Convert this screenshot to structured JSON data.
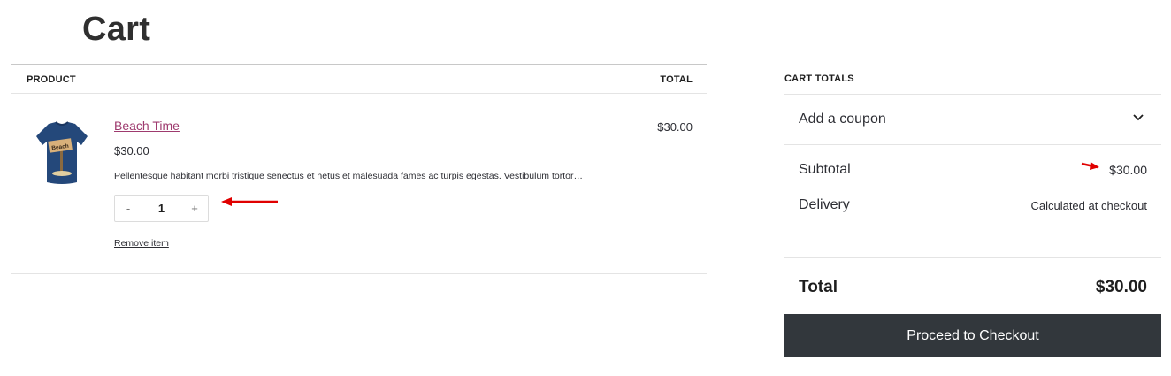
{
  "page": {
    "title": "Cart"
  },
  "cart_table": {
    "headers": {
      "product": "PRODUCT",
      "total": "TOTAL"
    },
    "items": [
      {
        "name": "Beach Time",
        "price": "$30.00",
        "description": "Pellentesque habitant morbi tristique senectus et netus et malesuada fames ac turpis egestas. Vestibulum tortor…",
        "quantity": "1",
        "qty_minus": "-",
        "qty_plus": "+",
        "remove_label": "Remove item",
        "line_total": "$30.00",
        "thumbnail_sign": "Beach"
      }
    ]
  },
  "totals": {
    "heading": "CART TOTALS",
    "coupon_label": "Add a coupon",
    "subtotal_label": "Subtotal",
    "subtotal_value": "$30.00",
    "delivery_label": "Delivery",
    "delivery_value": "Calculated at checkout",
    "total_label": "Total",
    "total_value": "$30.00",
    "checkout_label": "Proceed to Checkout"
  },
  "colors": {
    "accent_link": "#9e3a6e",
    "button_bg": "#32373c",
    "annotation_arrow": "#e00000"
  },
  "icons": [
    "chevron-down-icon",
    "annotation-arrow"
  ]
}
